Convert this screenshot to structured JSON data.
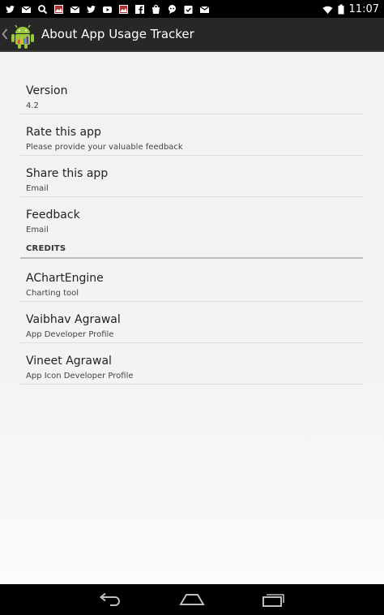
{
  "status_bar": {
    "time": "11:07",
    "notification_icons": [
      "twitter-icon",
      "gmail-icon",
      "search-icon",
      "photo-icon",
      "gmail-icon",
      "twitter-icon",
      "youtube-icon",
      "photo-icon",
      "facebook-icon",
      "store-icon",
      "chat-icon",
      "task-icon",
      "mail-icon"
    ],
    "status_icons": [
      "wifi-icon",
      "battery-icon"
    ]
  },
  "action_bar": {
    "title": "About App Usage Tracker"
  },
  "preferences": [
    {
      "title": "Version",
      "summary": "4.2"
    },
    {
      "title": "Rate this app",
      "summary": "Please provide your valuable feedback"
    },
    {
      "title": "Share this app",
      "summary": "Email"
    },
    {
      "title": "Feedback",
      "summary": "Email"
    }
  ],
  "credits": {
    "header": "CREDITS",
    "items": [
      {
        "title": "AChartEngine",
        "summary": "Charting tool"
      },
      {
        "title": "Vaibhav Agrawal",
        "summary": "App Developer Profile"
      },
      {
        "title": "Vineet Agrawal",
        "summary": "App Icon Developer Profile"
      }
    ]
  },
  "nav_bar": {
    "buttons": [
      "back-icon",
      "home-icon",
      "recents-icon"
    ]
  },
  "colors": {
    "action_bar": "#272727",
    "background": "#f2f2f2",
    "divider": "#dcdcdc",
    "android_green": "#9bc73b"
  }
}
